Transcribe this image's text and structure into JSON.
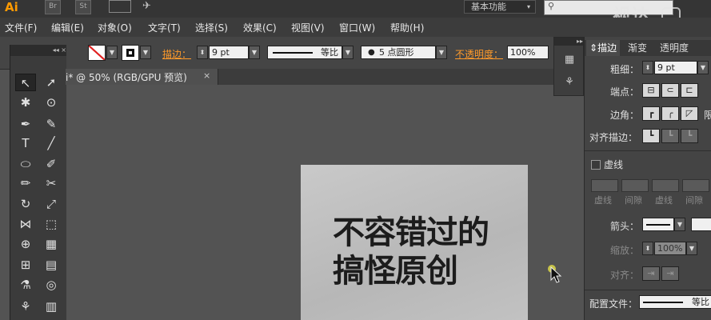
{
  "app": {
    "logo": "Ai",
    "bridge_label": "Br",
    "stock_label": "St",
    "workspace": "基本功能",
    "watermark": "视达"
  },
  "menu": [
    "文件(F)",
    "编辑(E)",
    "对象(O)",
    "文字(T)",
    "选择(S)",
    "效果(C)",
    "视图(V)",
    "窗口(W)",
    "帮助(H)"
  ],
  "control_bar": {
    "stroke_label": "描边：",
    "stroke_weight": "9 pt",
    "profile_label": "等比",
    "brush_label": "5 点圆形",
    "opacity_label": "不透明度：",
    "opacity_value": "100%"
  },
  "document_tab": {
    "title": "i* @ 50% (RGB/GPU 预览)",
    "close": "×"
  },
  "artwork_text": [
    "不容错过的",
    "搞怪原创"
  ],
  "stroke_panel": {
    "tabs": [
      "描边",
      "渐变",
      "透明度"
    ],
    "weight_label": "粗细：",
    "weight_value": "9 pt",
    "cap_label": "端点：",
    "corner_label": "边角：",
    "align_label": "对齐描边：",
    "dashed_label": "虚线",
    "dash_labels": [
      "虚线",
      "间隙",
      "虚线",
      "间隙"
    ],
    "arrow_label": "箭头：",
    "scale_label": "缩放：",
    "scale_value": "100%",
    "align2_label": "对齐：",
    "profile_label": "配置文件：",
    "profile_value": "等比"
  },
  "colors": {
    "accent": "#ff9a2a",
    "background": "#535353",
    "panel": "#444444"
  }
}
